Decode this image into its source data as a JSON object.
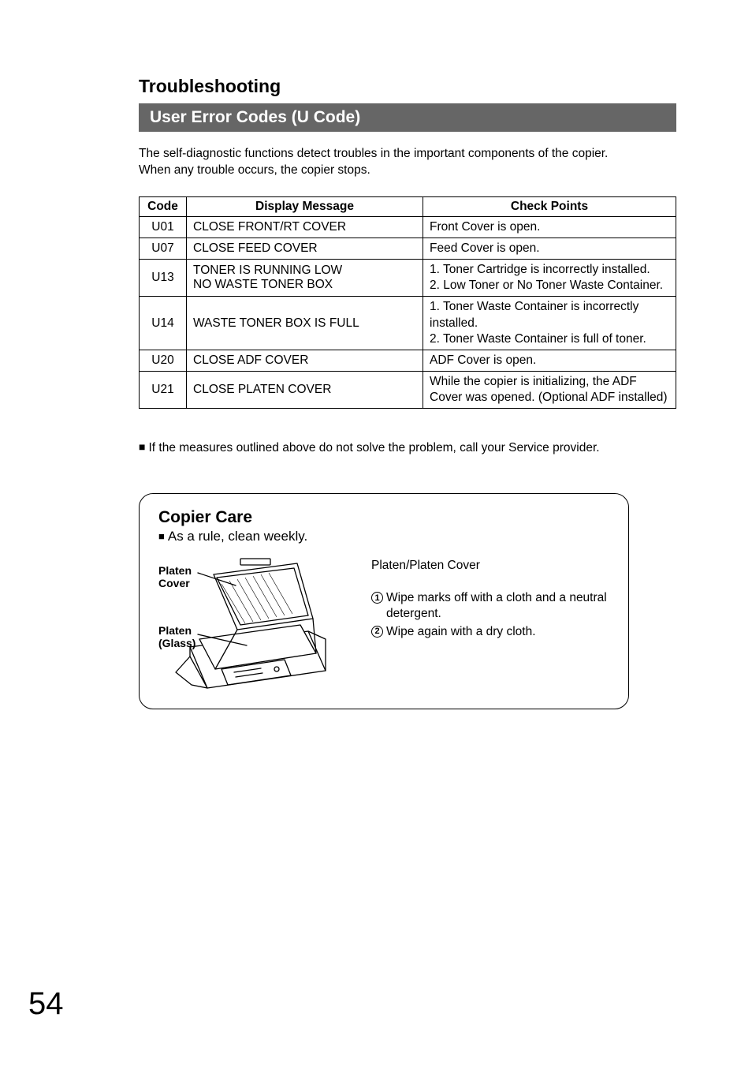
{
  "page_number": "54",
  "section_title": "Troubleshooting",
  "heading_bar": "User Error Codes (U Code)",
  "intro_line1": "The self-diagnostic functions detect troubles in the important components of the copier.",
  "intro_line2": "When any trouble occurs, the copier stops.",
  "table": {
    "headers": {
      "code": "Code",
      "display": "Display Message",
      "check": "Check Points"
    },
    "rows": [
      {
        "code": "U01",
        "display": "CLOSE FRONT/RT COVER",
        "check": "Front Cover is open."
      },
      {
        "code": "U07",
        "display": "CLOSE FEED COVER",
        "check": "Feed Cover is open."
      },
      {
        "code": "U13",
        "display": "TONER IS RUNNING LOW\nNO WASTE TONER BOX",
        "check": "1. Toner Cartridge is incorrectly installed.\n2. Low Toner or No Toner Waste Container."
      },
      {
        "code": "U14",
        "display": "WASTE TONER BOX IS FULL",
        "check": "1. Toner Waste Container is incorrectly\n    installed.\n2. Toner Waste Container is full of toner."
      },
      {
        "code": "U20",
        "display": "CLOSE ADF COVER",
        "check": "ADF Cover is open."
      },
      {
        "code": "U21",
        "display": "CLOSE PLATEN COVER",
        "check": "While the copier is initializing, the ADF Cover was opened. (Optional ADF installed)"
      }
    ]
  },
  "note": "If the measures outlined above do not solve the problem, call your Service provider.",
  "care": {
    "title": "Copier Care",
    "subtitle": "As a rule, clean weekly.",
    "label_cover": "Platen\nCover",
    "label_glass": "Platen\n(Glass)",
    "right_header": "Platen/Platen Cover",
    "step1": "Wipe marks off with a cloth and a neutral detergent.",
    "step2": "Wipe again with a dry cloth."
  }
}
